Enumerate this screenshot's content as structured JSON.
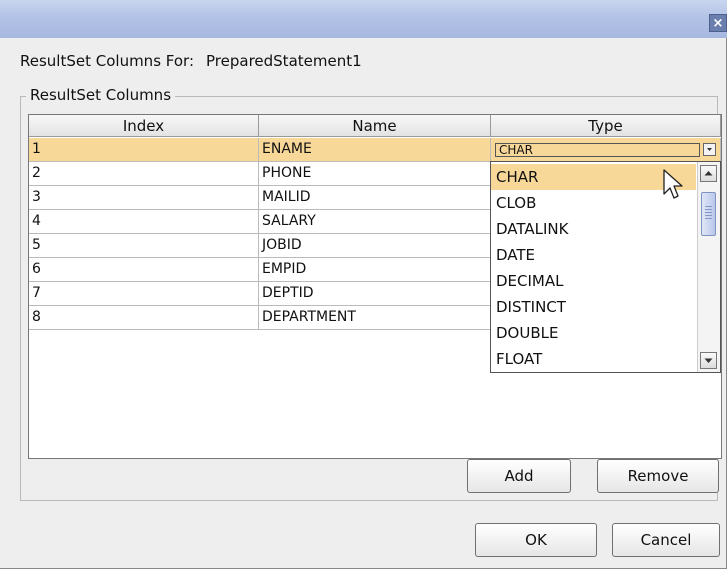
{
  "window": {
    "close_glyph": "×"
  },
  "header": {
    "label": "ResultSet Columns For:",
    "value": "PreparedStatement1"
  },
  "group": {
    "title": "ResultSet Columns"
  },
  "table": {
    "columns": [
      "Index",
      "Name",
      "Type"
    ],
    "rows": [
      {
        "index": "1",
        "name": "ENAME"
      },
      {
        "index": "2",
        "name": "PHONE"
      },
      {
        "index": "3",
        "name": "MAILID"
      },
      {
        "index": "4",
        "name": "SALARY"
      },
      {
        "index": "5",
        "name": "JOBID"
      },
      {
        "index": "6",
        "name": "EMPID"
      },
      {
        "index": "7",
        "name": "DEPTID"
      },
      {
        "index": "8",
        "name": "DEPARTMENT"
      }
    ],
    "selected_row_index": 0,
    "type_editor": {
      "value": "CHAR"
    }
  },
  "dropdown": {
    "options": [
      "CHAR",
      "CLOB",
      "DATALINK",
      "DATE",
      "DECIMAL",
      "DISTINCT",
      "DOUBLE",
      "FLOAT"
    ],
    "highlighted_index": 0
  },
  "buttons": {
    "add": "Add",
    "remove": "Remove",
    "ok": "OK",
    "cancel": "Cancel"
  },
  "colors": {
    "selection": "#f8d898",
    "titlebar": "#b3c2e6",
    "background": "#eeeeee"
  },
  "icons": {
    "close": "close-icon",
    "combo_arrow": "chevron-down-icon",
    "scroll_up": "arrow-up-icon",
    "scroll_down": "arrow-down-icon",
    "pointer": "mouse-pointer-icon"
  }
}
